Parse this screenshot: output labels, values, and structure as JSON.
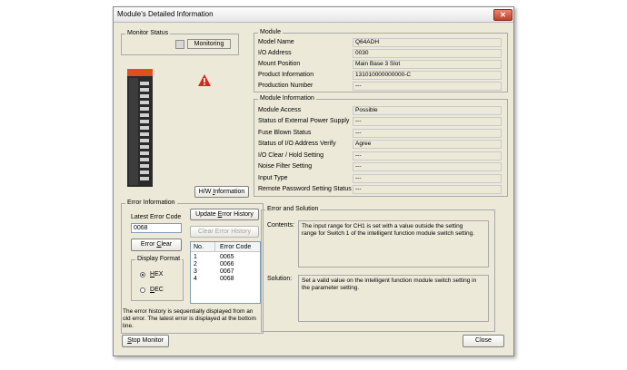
{
  "window": {
    "title": "Module's Detailed Information",
    "close_glyph": "✕"
  },
  "monitor_status": {
    "group_title": "Monitor Status",
    "status": "Monitoring"
  },
  "module": {
    "group_title": "Module",
    "fields": [
      {
        "label": "Model Name",
        "value": "Q64ADH"
      },
      {
        "label": "I/O Address",
        "value": "0030"
      },
      {
        "label": "Mount Position",
        "value": "Main Base  3 Slot"
      },
      {
        "label": "Product Information",
        "value": "131010000000000-C"
      },
      {
        "label": "Production Number",
        "value": "---"
      }
    ]
  },
  "module_information": {
    "group_title": "Module Information",
    "fields": [
      {
        "label": "Module Access",
        "value": "Possible"
      },
      {
        "label": "Status of External Power Supply",
        "value": "---"
      },
      {
        "label": "Fuse Blown Status",
        "value": "---"
      },
      {
        "label": "Status of I/O Address Verify",
        "value": "Agree"
      },
      {
        "label": "I/O Clear / Hold Setting",
        "value": "---"
      },
      {
        "label": "Noise Filter Setting",
        "value": "---"
      },
      {
        "label": "Input Type",
        "value": "---"
      },
      {
        "label": "Remote Password Setting Status",
        "value": "---"
      }
    ]
  },
  "hw_information_button": {
    "pre": "H/W ",
    "key": "I",
    "post": "nformation"
  },
  "error_information": {
    "group_title": "Error Information",
    "latest_label": "Latest Error Code",
    "latest_value": "0068",
    "update_button": {
      "pre": "Update ",
      "key": "E",
      "post": "rror History"
    },
    "clear_history_button": "Clear Error History",
    "error_clear_button": {
      "pre": "Error ",
      "key": "C",
      "post": "lear"
    },
    "display_format": {
      "title": "Display Format",
      "hex": {
        "key": "H",
        "post": "EX"
      },
      "dec": {
        "key": "D",
        "post": "EC"
      },
      "selected": "HEX"
    },
    "table": {
      "columns": [
        "No.",
        "Error Code"
      ],
      "rows": [
        {
          "no": "1",
          "code": "0065"
        },
        {
          "no": "2",
          "code": "0066"
        },
        {
          "no": "3",
          "code": "0067"
        },
        {
          "no": "4",
          "code": "0068"
        }
      ]
    },
    "note": "The error history is sequentially displayed from an old error. The latest error is displayed at the bottom line."
  },
  "error_and_solution": {
    "group_title": "Error and Solution",
    "contents_label": "Contents:",
    "contents_text": "The input range for CH1 is set with a value outside the setting range for Switch 1 of the intelligent function module switch setting.",
    "solution_label": "Solution:",
    "solution_text": "Set a valid value on the intelligent function module switch setting in the parameter setting."
  },
  "bottom": {
    "stop_monitor": {
      "key": "S",
      "post": "top Monitor"
    },
    "close": "Close"
  },
  "colors": {
    "window_bg": "#ece9d8",
    "warning_red": "#d9251c",
    "module_orange": "#e0501c"
  }
}
